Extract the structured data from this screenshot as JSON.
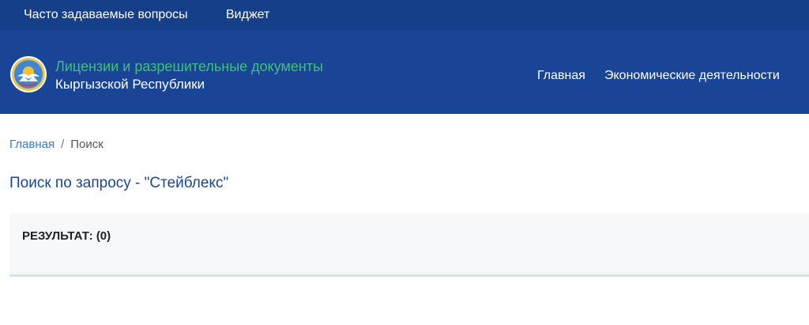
{
  "topbar": {
    "links": [
      "Часто задаваемые вопросы",
      "Виджет"
    ]
  },
  "header": {
    "title_line1": "Лицензии и разрешительные документы",
    "title_line2": "Кыргызской Республики",
    "nav": [
      "Главная",
      "Экономические деятельности"
    ]
  },
  "breadcrumb": {
    "home": "Главная",
    "separator": "/",
    "current": "Поиск"
  },
  "page": {
    "title": "Поиск по запросу - \"Стейблекс\""
  },
  "results": {
    "label": "РЕЗУЛЬТАТ: (0)"
  },
  "colors": {
    "topbar_bg": "#163f8a",
    "header_bg": "#1a4596",
    "brand_green": "#3ec07b",
    "link_blue": "#3a78c9"
  },
  "icons": {
    "emblem": "state-emblem-icon"
  }
}
